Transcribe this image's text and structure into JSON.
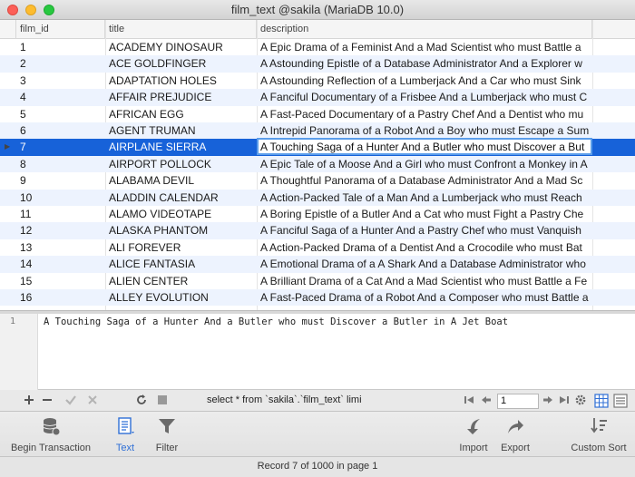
{
  "window": {
    "title": "film_text @sakila (MariaDB 10.0)"
  },
  "grid": {
    "columns": [
      "film_id",
      "title",
      "description"
    ],
    "selected_row_index": 6,
    "rows": [
      [
        "1",
        "ACADEMY DINOSAUR",
        "A Epic Drama of a Feminist And a Mad Scientist who must Battle a"
      ],
      [
        "2",
        "ACE GOLDFINGER",
        "A Astounding Epistle of a Database Administrator And a Explorer w"
      ],
      [
        "3",
        "ADAPTATION HOLES",
        "A Astounding Reflection of a Lumberjack And a Car who must Sink"
      ],
      [
        "4",
        "AFFAIR PREJUDICE",
        "A Fanciful Documentary of a Frisbee And a Lumberjack who must C"
      ],
      [
        "5",
        "AFRICAN EGG",
        "A Fast-Paced Documentary of a Pastry Chef And a Dentist who mu"
      ],
      [
        "6",
        "AGENT TRUMAN",
        "A Intrepid Panorama of a Robot And a Boy who must Escape a Sum"
      ],
      [
        "7",
        "AIRPLANE SIERRA",
        "A Touching Saga of a Hunter And a Butler who must Discover a But"
      ],
      [
        "8",
        "AIRPORT POLLOCK",
        "A Epic Tale of a Moose And a Girl who must Confront a Monkey in A"
      ],
      [
        "9",
        "ALABAMA DEVIL",
        "A Thoughtful Panorama of a Database Administrator And a Mad Sc"
      ],
      [
        "10",
        "ALADDIN CALENDAR",
        "A Action-Packed Tale of a Man And a Lumberjack who must Reach"
      ],
      [
        "11",
        "ALAMO VIDEOTAPE",
        "A Boring Epistle of a Butler And a Cat who must Fight a Pastry Che"
      ],
      [
        "12",
        "ALASKA PHANTOM",
        "A Fanciful Saga of a Hunter And a Pastry Chef who must Vanquish"
      ],
      [
        "13",
        "ALI FOREVER",
        "A Action-Packed Drama of a Dentist And a Crocodile who must Bat"
      ],
      [
        "14",
        "ALICE FANTASIA",
        "A Emotional Drama of a A Shark And a Database Administrator who"
      ],
      [
        "15",
        "ALIEN CENTER",
        "A Brilliant Drama of a Cat And a Mad Scientist who must Battle a Fe"
      ],
      [
        "16",
        "ALLEY EVOLUTION",
        "A Fast-Paced Drama of a Robot And a Composer who must Battle a"
      ]
    ]
  },
  "editor": {
    "line_number": "1",
    "text": "A Touching Saga of a Hunter And a Butler who must Discover a Butler in A Jet Boat"
  },
  "nav": {
    "query": "select * from `sakila`.`film_text` limi",
    "page_value": "1"
  },
  "toolbar": {
    "begin_transaction": "Begin Transaction",
    "text": "Text",
    "filter": "Filter",
    "import": "Import",
    "export": "Export",
    "custom_sort": "Custom Sort"
  },
  "status": {
    "text": "Record 7 of 1000 in page 1"
  }
}
